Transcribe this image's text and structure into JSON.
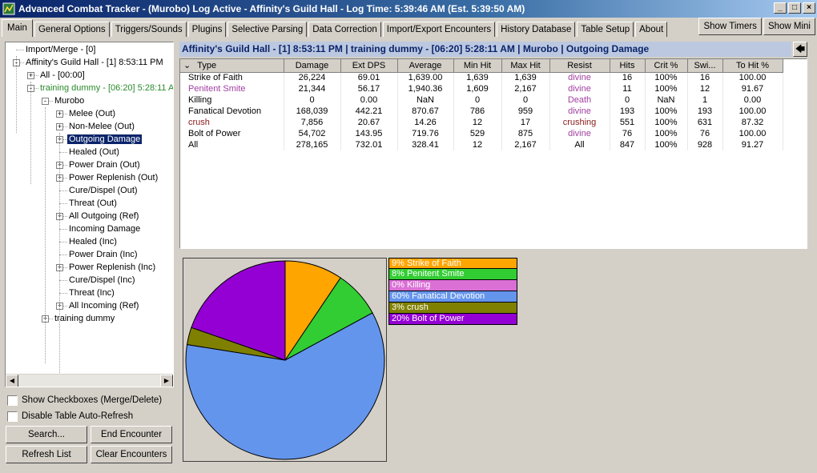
{
  "window": {
    "title": "Advanced Combat Tracker - (Murobo) Log Active - Affinity's Guild Hall - Log Time: 5:39:46 AM (Est. 5:39:50 AM)",
    "min_glyph": "_",
    "max_glyph": "□",
    "close_glyph": "×"
  },
  "tabs": [
    "Main",
    "General Options",
    "Triggers/Sounds",
    "Plugins",
    "Selective Parsing",
    "Data Correction",
    "Import/Export Encounters",
    "History Database",
    "Table Setup",
    "About"
  ],
  "top_buttons": {
    "show_timers": "Show Timers",
    "show_mini": "Show Mini"
  },
  "tree": [
    {
      "label": "Import/Merge - [0]",
      "indent": 0,
      "expander": ""
    },
    {
      "label": "Affinity's Guild Hall - [1] 8:53:11 PM",
      "indent": 0,
      "expander": "-"
    },
    {
      "label": "All - [00:00]",
      "indent": 1,
      "expander": "+"
    },
    {
      "label": "training dummy - [06:20] 5:28:11 AM",
      "indent": 1,
      "expander": "-",
      "green": true
    },
    {
      "label": "Murobo",
      "indent": 2,
      "expander": "-"
    },
    {
      "label": "Melee (Out)",
      "indent": 3,
      "expander": "+"
    },
    {
      "label": "Non-Melee (Out)",
      "indent": 3,
      "expander": "+"
    },
    {
      "label": "Outgoing Damage",
      "indent": 3,
      "expander": "+",
      "selected": true
    },
    {
      "label": "Healed (Out)",
      "indent": 3,
      "expander": ""
    },
    {
      "label": "Power Drain (Out)",
      "indent": 3,
      "expander": "+"
    },
    {
      "label": "Power Replenish (Out)",
      "indent": 3,
      "expander": "+"
    },
    {
      "label": "Cure/Dispel (Out)",
      "indent": 3,
      "expander": ""
    },
    {
      "label": "Threat (Out)",
      "indent": 3,
      "expander": ""
    },
    {
      "label": "All Outgoing (Ref)",
      "indent": 3,
      "expander": "+"
    },
    {
      "label": "Incoming Damage",
      "indent": 3,
      "expander": ""
    },
    {
      "label": "Healed (Inc)",
      "indent": 3,
      "expander": ""
    },
    {
      "label": "Power Drain (Inc)",
      "indent": 3,
      "expander": ""
    },
    {
      "label": "Power Replenish (Inc)",
      "indent": 3,
      "expander": "+"
    },
    {
      "label": "Cure/Dispel (Inc)",
      "indent": 3,
      "expander": ""
    },
    {
      "label": "Threat (Inc)",
      "indent": 3,
      "expander": ""
    },
    {
      "label": "All Incoming (Ref)",
      "indent": 3,
      "expander": "+"
    },
    {
      "label": "training dummy",
      "indent": 2,
      "expander": "+"
    }
  ],
  "options": {
    "show_checkboxes": "Show Checkboxes (Merge/Delete)",
    "disable_refresh": "Disable Table Auto-Refresh"
  },
  "buttons": {
    "search": "Search...",
    "end_encounter": "End Encounter",
    "refresh_list": "Refresh List",
    "clear_encounters": "Clear Encounters"
  },
  "header": "Affinity's Guild Hall - [1] 8:53:11 PM | training dummy - [06:20] 5:28:11 AM | Murobo | Outgoing Damage",
  "table": {
    "columns": [
      "Type",
      "Damage",
      "Ext DPS",
      "Average",
      "Min Hit",
      "Max Hit",
      "Resist",
      "Hits",
      "Crit %",
      "Swi...",
      "To Hit %"
    ],
    "sort_glyph": "⌄",
    "rows": [
      {
        "cells": [
          "Strike of Faith",
          "26,224",
          "69.01",
          "1,639.00",
          "1,639",
          "1,639",
          "divine",
          "16",
          "100%",
          "16",
          "100.00"
        ],
        "name_color": "#000000",
        "resist_color": "#a040a0"
      },
      {
        "cells": [
          "Penitent Smite",
          "21,344",
          "56.17",
          "1,940.36",
          "1,609",
          "2,167",
          "divine",
          "11",
          "100%",
          "12",
          "91.67"
        ],
        "name_color": "#a040a0",
        "resist_color": "#a040a0"
      },
      {
        "cells": [
          "Killing",
          "0",
          "0.00",
          "NaN",
          "0",
          "0",
          "Death",
          "0",
          "NaN",
          "1",
          "0.00"
        ],
        "name_color": "#000000",
        "resist_color": "#a040a0"
      },
      {
        "cells": [
          "Fanatical Devotion",
          "168,039",
          "442.21",
          "870.67",
          "786",
          "959",
          "divine",
          "193",
          "100%",
          "193",
          "100.00"
        ],
        "name_color": "#000000",
        "resist_color": "#a040a0"
      },
      {
        "cells": [
          "crush",
          "7,856",
          "20.67",
          "14.26",
          "12",
          "17",
          "crushing",
          "551",
          "100%",
          "631",
          "87.32"
        ],
        "name_color": "#8b1a1a",
        "resist_color": "#8b1a1a"
      },
      {
        "cells": [
          "Bolt of Power",
          "54,702",
          "143.95",
          "719.76",
          "529",
          "875",
          "divine",
          "76",
          "100%",
          "76",
          "100.00"
        ],
        "name_color": "#000000",
        "resist_color": "#a040a0"
      },
      {
        "cells": [
          "All",
          "278,165",
          "732.01",
          "328.41",
          "12",
          "2,167",
          "All",
          "847",
          "100%",
          "928",
          "91.27"
        ],
        "name_color": "#000000",
        "resist_color": "#000000"
      }
    ]
  },
  "chart_data": {
    "type": "pie",
    "categories": [
      "Strike of Faith",
      "Penitent Smite",
      "Killing",
      "Fanatical Devotion",
      "crush",
      "Bolt of Power"
    ],
    "values": [
      26224,
      21344,
      0,
      168039,
      7856,
      54702
    ],
    "legend": [
      "9%   Strike of Faith",
      "8%   Penitent Smite",
      "0%   Killing",
      "60% Fanatical Devotion",
      "3%   crush",
      "20% Bolt of Power"
    ],
    "colors": [
      "#ffa500",
      "#32cd32",
      "#da70d6",
      "#6495ed",
      "#808000",
      "#9400d3"
    ],
    "legend_placement": "right"
  }
}
